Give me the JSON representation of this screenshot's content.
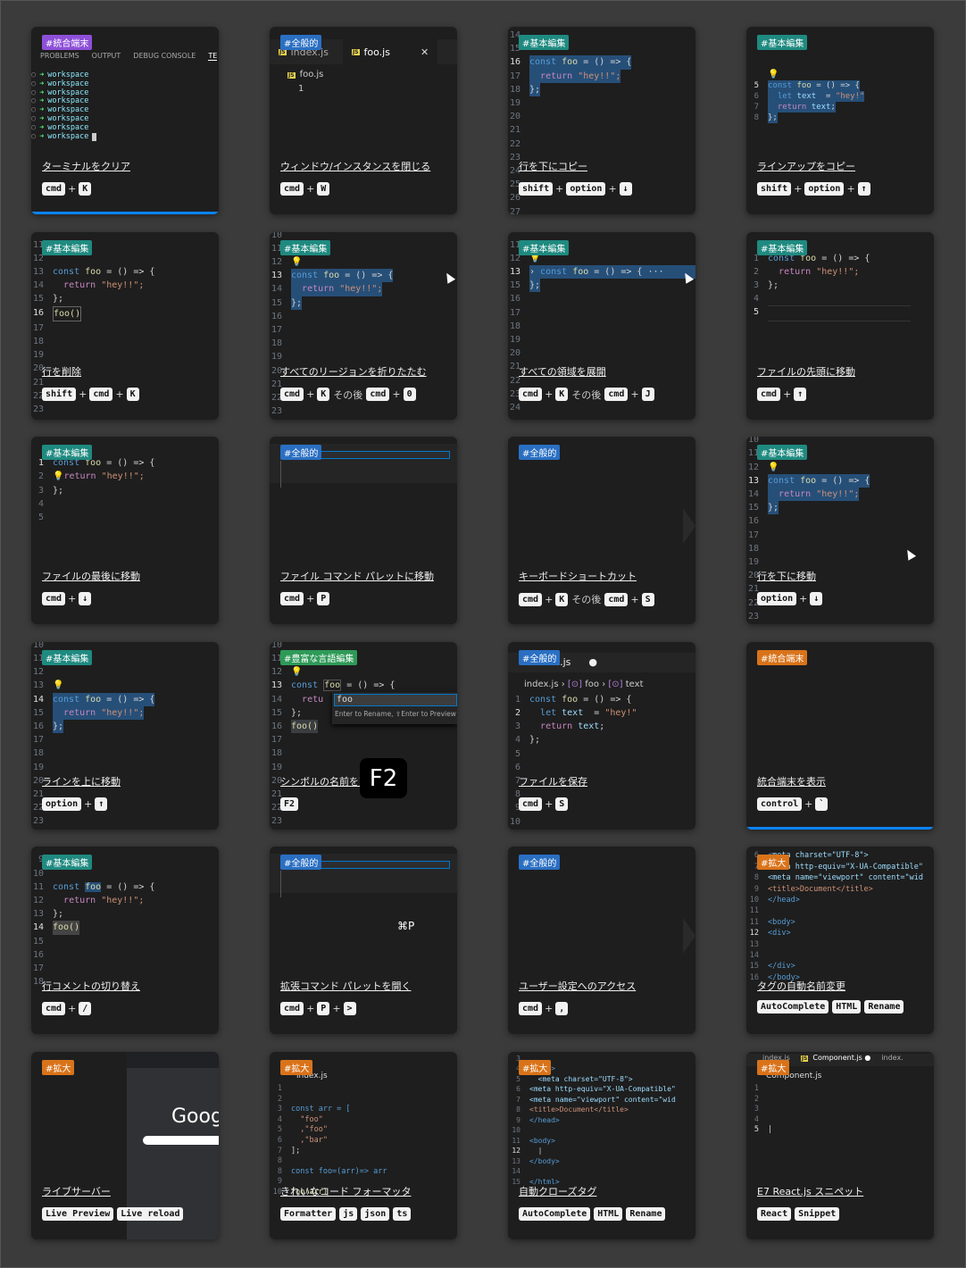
{
  "cards": [
    {
      "tag": "#統合端末",
      "title": "ターミナルをクリア",
      "keys": [
        "cmd",
        "+",
        "K"
      ]
    },
    {
      "tag": "#全般的",
      "title": "ウィンドウ/インスタンスを閉じる",
      "keys": [
        "cmd",
        "+",
        "W"
      ]
    },
    {
      "tag": "#基本編集",
      "title": "行を下にコピー",
      "keys": [
        "shift",
        "+",
        "option",
        "+",
        "↓"
      ]
    },
    {
      "tag": "#基本編集",
      "title": "ラインアップをコピー",
      "keys": [
        "shift",
        "+",
        "option",
        "+",
        "↑"
      ]
    },
    {
      "tag": "#基本編集",
      "title": "行を削除",
      "keys": [
        "shift",
        "+",
        "cmd",
        "+",
        "K"
      ]
    },
    {
      "tag": "#基本編集",
      "title": "すべてのリージョンを折りたたむ",
      "keys": [
        "cmd",
        "+",
        "K",
        "その後",
        "cmd",
        "+",
        "0"
      ]
    },
    {
      "tag": "#基本編集",
      "title": "すべての領域を展開",
      "keys": [
        "cmd",
        "+",
        "K",
        "その後",
        "cmd",
        "+",
        "J"
      ]
    },
    {
      "tag": "#基本編集",
      "title": "ファイルの先頭に移動",
      "keys": [
        "cmd",
        "+",
        "↑"
      ]
    },
    {
      "tag": "#基本編集",
      "title": "ファイルの最後に移動",
      "keys": [
        "cmd",
        "+",
        "↓"
      ]
    },
    {
      "tag": "#全般的",
      "title": "ファイル コマンド パレットに移動",
      "keys": [
        "cmd",
        "+",
        "P"
      ]
    },
    {
      "tag": "#全般的",
      "title": "キーボードショートカット",
      "keys": [
        "cmd",
        "+",
        "K",
        "その後",
        "cmd",
        "+",
        "S"
      ]
    },
    {
      "tag": "#基本編集",
      "title": "行を下に移動",
      "keys": [
        "option",
        "+",
        "↓"
      ]
    },
    {
      "tag": "#基本編集",
      "title": "ラインを上に移動",
      "keys": [
        "option",
        "+",
        "↑"
      ]
    },
    {
      "tag": "#豊富な言語編集",
      "title": "シンボルの名前を変更",
      "keys": [
        "F2"
      ]
    },
    {
      "tag": "#全般的",
      "title": "ファイルを保存",
      "keys": [
        "cmd",
        "+",
        "S"
      ]
    },
    {
      "tag": "#統合端末",
      "title": "統合端末を表示",
      "keys": [
        "control",
        "+",
        "`"
      ]
    },
    {
      "tag": "#基本編集",
      "title": "行コメントの切り替え",
      "keys": [
        "cmd",
        "+",
        "/"
      ]
    },
    {
      "tag": "#全般的",
      "title": "拡張コマンド パレットを開く",
      "keys": [
        "cmd",
        "+",
        "P",
        "+",
        ">"
      ]
    },
    {
      "tag": "#全般的",
      "title": "ユーザー設定へのアクセス",
      "keys": [
        "cmd",
        "+",
        ","
      ]
    },
    {
      "tag": "#拡大",
      "title": "タグの自動名前変更",
      "keys": [
        "AutoComplete",
        "HTML",
        "Rename"
      ]
    },
    {
      "tag": "#拡大",
      "title": "ライブサーバー",
      "keys": [
        "Live Preview",
        "Live reload"
      ]
    },
    {
      "tag": "#拡大",
      "title": "きれいなコード フォーマッタ",
      "keys": [
        "Formatter",
        "js",
        "json",
        "ts"
      ]
    },
    {
      "tag": "#拡大",
      "title": "自動クローズタグ",
      "keys": [
        "AutoComplete",
        "HTML",
        "Rename"
      ]
    },
    {
      "tag": "#拡大",
      "title": "E7 React.js スニペット",
      "keys": [
        "React",
        "Snippet"
      ]
    }
  ],
  "terminal": {
    "tabs": [
      "PROBLEMS",
      "OUTPUT",
      "DEBUG CONSOLE",
      "TE"
    ],
    "lines": [
      "workspace",
      "workspace",
      "workspace",
      "workspace",
      "workspace",
      "workspace",
      "workspace",
      "workspace"
    ]
  },
  "closewin": {
    "tab1": "index.js",
    "tab2": "foo.js",
    "file": "foo.js",
    "line": "1"
  },
  "code": {
    "const_kw": "const",
    "foo": "foo",
    "eq_arrow": " = () => {",
    "return_kw": "return",
    "hey": "\"hey!!\";",
    "close": "};",
    "call": "foo()"
  },
  "rename": {
    "input": "foo",
    "hint": "Enter to Rename, ⇧Enter to Preview",
    "badge": "F2"
  },
  "save": {
    "tab": "index.js",
    "crumb1": "index.js",
    "crumb2": "foo",
    "crumb3": "text"
  },
  "ext_palette_badge": "⌘P",
  "google_logo": "Googl",
  "html_lines": [
    "meta charset=\"UTF-8\">",
    "<meta http-equiv=\"X-UA-Compatible\"",
    "<meta name=\"viewport\" content=\"wid",
    "<title>Document</title>",
    "</head>",
    "<body>",
    "<div>",
    "</div>",
    "</body>"
  ],
  "formatter_lines": [
    "const arr = [",
    "\"foo\"",
    ",\"foo\"",
    ",\"bar\"",
    "];",
    "const foo=(arr)=> arr",
    "foo(arr)"
  ],
  "react_tabs": [
    "index.js",
    "Component.js",
    "index."
  ],
  "react_file": "Component.js"
}
